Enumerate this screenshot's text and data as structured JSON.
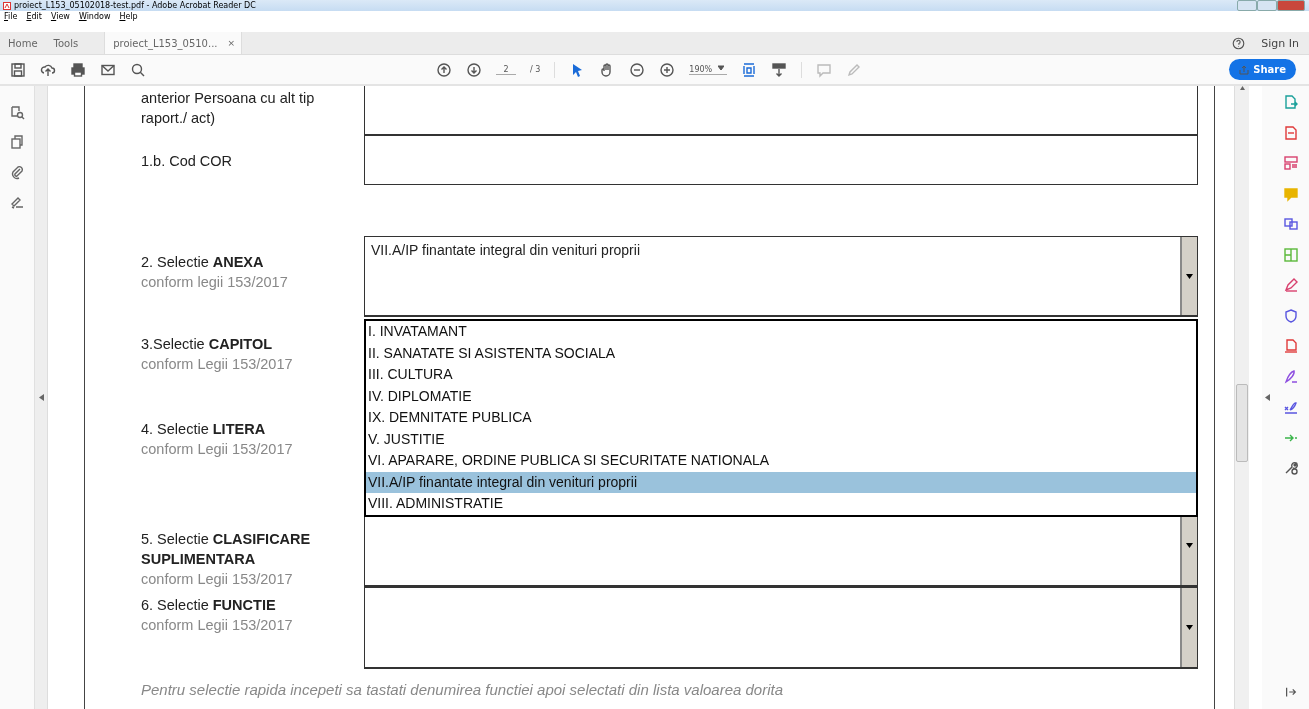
{
  "window": {
    "title": "proiect_L153_05102018-test.pdf - Adobe Acrobat Reader DC"
  },
  "menu": [
    "File",
    "Edit",
    "View",
    "Window",
    "Help"
  ],
  "tabs": [
    {
      "label": "Home",
      "selected": false
    },
    {
      "label": "Tools",
      "selected": false
    },
    {
      "label": "proiect_L153_0510...",
      "selected": true,
      "close": "×"
    }
  ],
  "account": {
    "sign_in": "Sign In"
  },
  "toolbar": {
    "page": "2",
    "page_count": "/ 3",
    "zoom": "190%",
    "share": "Share"
  },
  "form": {
    "rows": [
      {
        "label": "anterior  Persoana cu alt tip raport./ act)",
        "field": {
          "kind": "text"
        }
      },
      {
        "label": "1.b. Cod COR",
        "field": {
          "kind": "text"
        }
      },
      {
        "label": "2. Selectie **ANEXA**",
        "note": "conform legii 153/2017",
        "field": {
          "kind": "dropdown",
          "value": "VII.A/IP finantate integral din venituri proprii",
          "options": [
            {
              "label": "I. INVATAMANT",
              "selected": false
            },
            {
              "label": "II. SANATATE SI ASISTENTA SOCIALA",
              "selected": false
            },
            {
              "label": "III. CULTURA",
              "selected": false
            },
            {
              "label": "IV. DIPLOMATIE",
              "selected": false
            },
            {
              "label": "IX. DEMNITATE PUBLICA",
              "selected": false
            },
            {
              "label": "V. JUSTITIE",
              "selected": false
            },
            {
              "label": "VI. APARARE, ORDINE PUBLICA SI SECURITATE NATIONALA",
              "selected": false
            },
            {
              "label": "VII.A/IP finantate integral din venituri proprii",
              "selected": true
            },
            {
              "label": "VIII. ADMINISTRATIE",
              "selected": false
            }
          ]
        }
      },
      {
        "label": "3.Selectie **CAPITOL**",
        "note": "conform Legii 153/2017"
      },
      {
        "label": "4. Selectie **LITERA**",
        "note": "conform Legii 153/2017"
      },
      {
        "label": "5. Selectie **CLASIFICARE SUPLIMENTARA**",
        "note": "conform Legii 153/2017",
        "field": {
          "kind": "dropdown"
        }
      },
      {
        "label": "6.  Selectie **FUNCTIE**",
        "note": "conform Legii 153/2017",
        "field": {
          "kind": "dropdown"
        }
      }
    ],
    "hint": "Pentru selectie rapida incepeti sa tastati denumirea functiei apoi selectati din lista valoarea dorita"
  }
}
